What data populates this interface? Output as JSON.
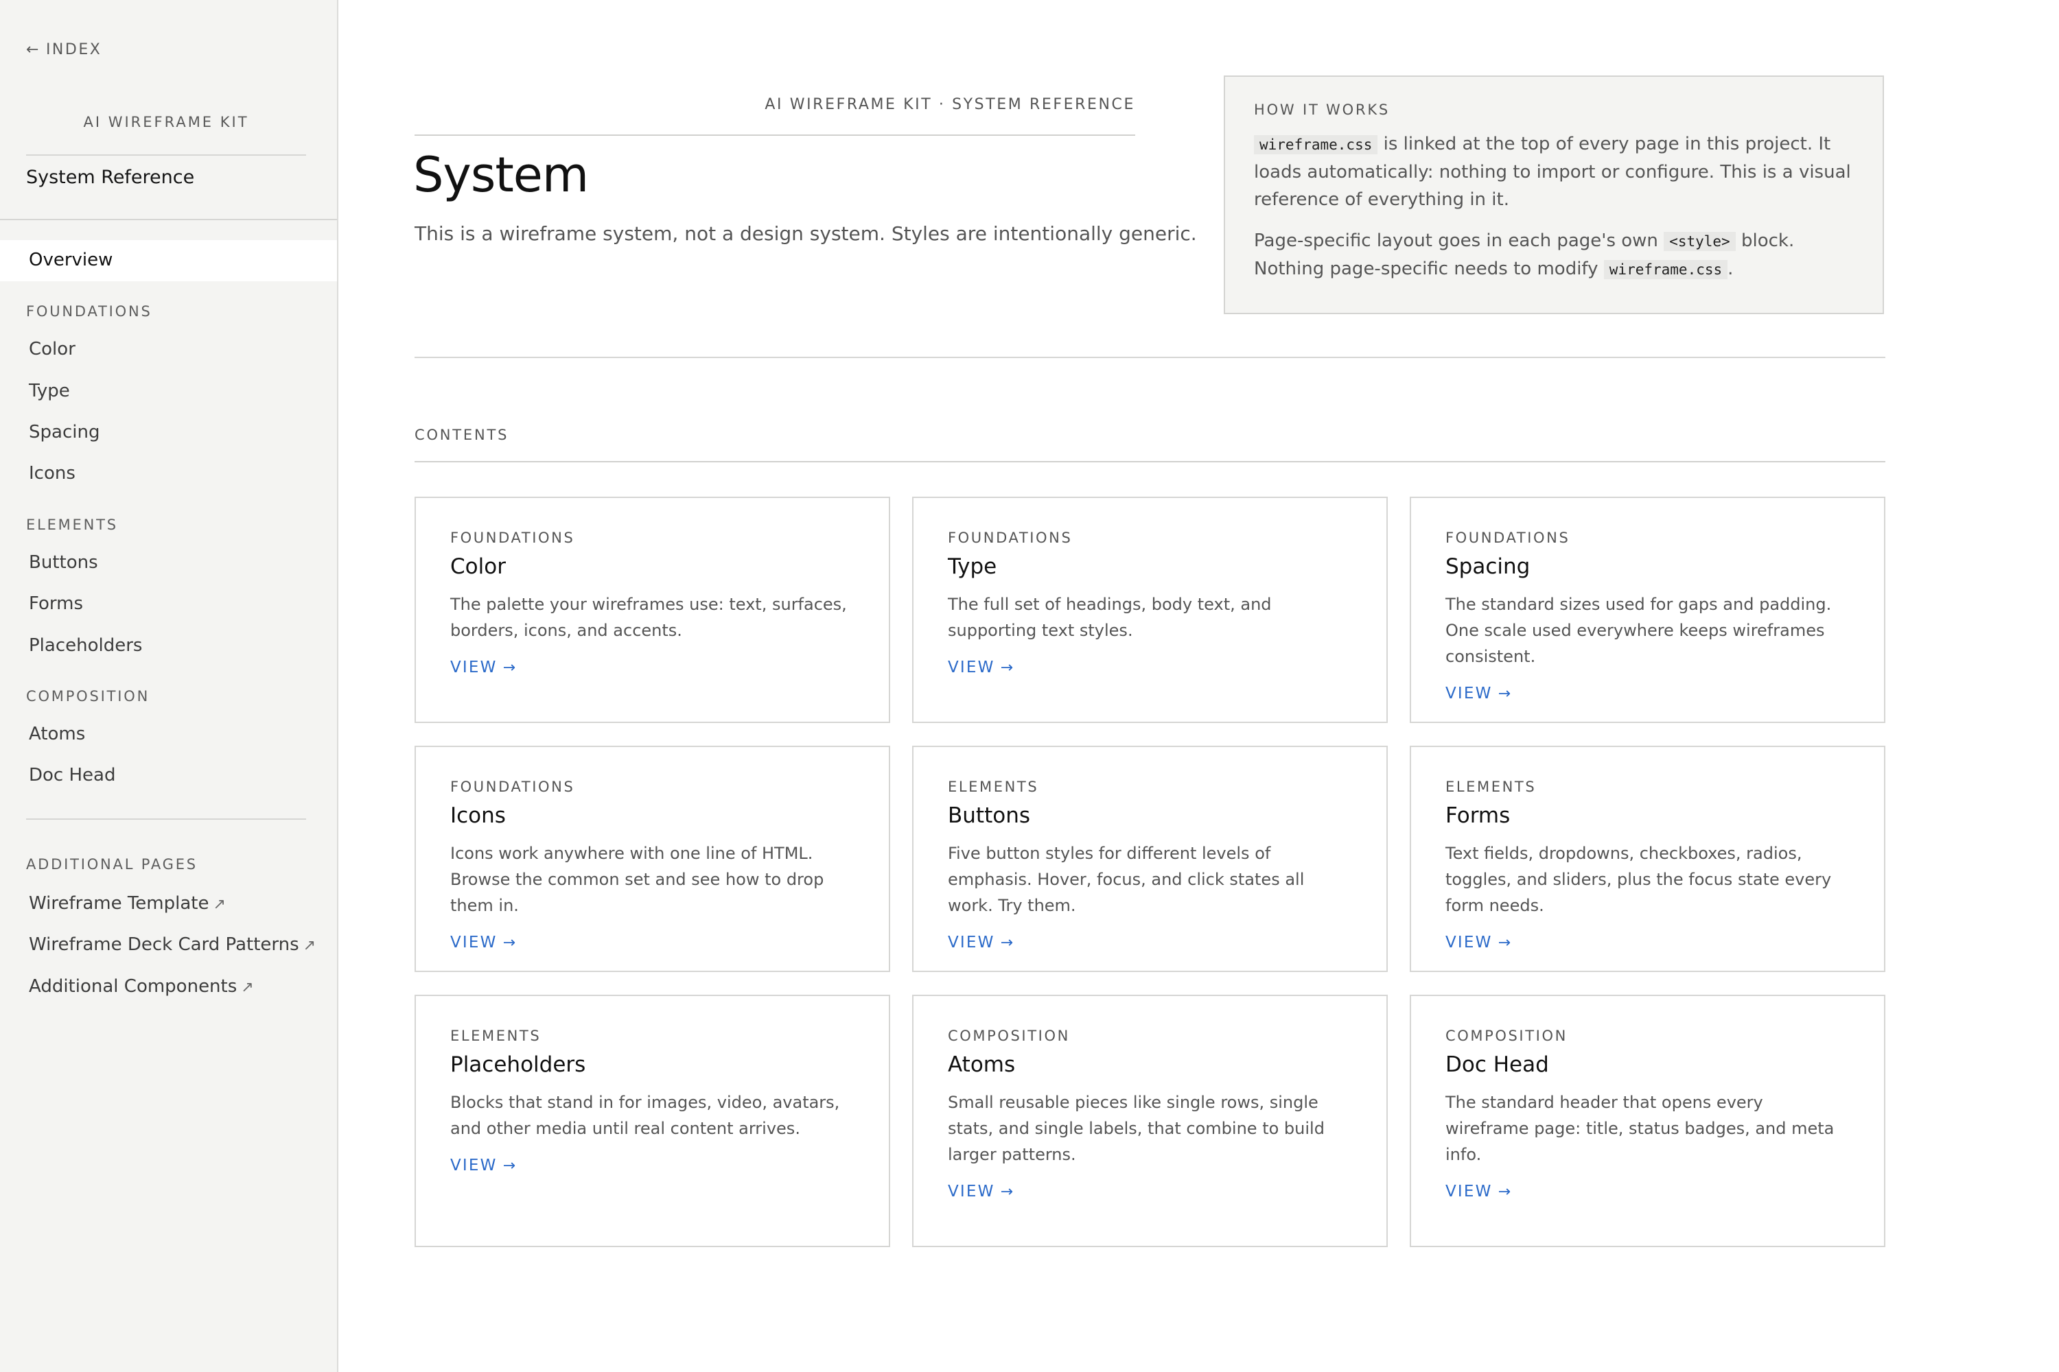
{
  "sidebar": {
    "back_label": "INDEX",
    "brand": "AI WIREFRAME KIT",
    "title": "System Reference",
    "overview": "Overview",
    "sections": [
      {
        "label": "FOUNDATIONS",
        "items": [
          "Color",
          "Type",
          "Spacing",
          "Icons"
        ]
      },
      {
        "label": "ELEMENTS",
        "items": [
          "Buttons",
          "Forms",
          "Placeholders"
        ]
      },
      {
        "label": "COMPOSITION",
        "items": [
          "Atoms",
          "Doc Head"
        ]
      }
    ],
    "additional": {
      "label": "ADDITIONAL PAGES",
      "items": [
        "Wireframe Template",
        "Wireframe Deck Card Patterns",
        "Additional Components"
      ]
    }
  },
  "header": {
    "kicker": "AI WIREFRAME KIT · SYSTEM REFERENCE",
    "title": "System",
    "subtitle": "This is a wireframe system, not a design system. Styles are intentionally generic."
  },
  "how_it_works": {
    "title": "HOW IT WORKS",
    "p1_code": "wireframe.css",
    "p1_text": " is linked at the top of every page in this project. It loads automatically: nothing to import or configure. This is a visual reference of everything in it.",
    "p2_text_a": "Page-specific layout goes in each page's own ",
    "p2_code_a": "<style>",
    "p2_text_b": " block. Nothing page-specific needs to modify ",
    "p2_code_b": "wireframe.css",
    "p2_text_c": "."
  },
  "contents": {
    "label": "CONTENTS",
    "link_label": "VIEW",
    "cards": [
      {
        "category": "FOUNDATIONS",
        "title": "Color",
        "desc": "The palette your wireframes use: text, surfaces, borders, icons, and accents."
      },
      {
        "category": "FOUNDATIONS",
        "title": "Type",
        "desc": "The full set of headings, body text, and supporting text styles."
      },
      {
        "category": "FOUNDATIONS",
        "title": "Spacing",
        "desc": "The standard sizes used for gaps and padding. One scale used everywhere keeps wireframes consistent."
      },
      {
        "category": "FOUNDATIONS",
        "title": "Icons",
        "desc": "Icons work anywhere with one line of HTML. Browse the common set and see how to drop them in."
      },
      {
        "category": "ELEMENTS",
        "title": "Buttons",
        "desc": "Five button styles for different levels of emphasis. Hover, focus, and click states all work. Try them."
      },
      {
        "category": "ELEMENTS",
        "title": "Forms",
        "desc": "Text fields, dropdowns, checkboxes, radios, toggles, and sliders, plus the focus state every form needs."
      },
      {
        "category": "ELEMENTS",
        "title": "Placeholders",
        "desc": "Blocks that stand in for images, video, avatars, and other media until real content arrives."
      },
      {
        "category": "COMPOSITION",
        "title": "Atoms",
        "desc": "Small reusable pieces like single rows, single stats, and single labels, that combine to build larger patterns."
      },
      {
        "category": "COMPOSITION",
        "title": "Doc Head",
        "desc": "The standard header that opens every wireframe page: title, status badges, and meta info."
      }
    ]
  },
  "colors": {
    "sidebar_bg": "#f4f4f2",
    "link_blue": "#2b6ac9",
    "text": "#111111",
    "muted": "#555555"
  }
}
